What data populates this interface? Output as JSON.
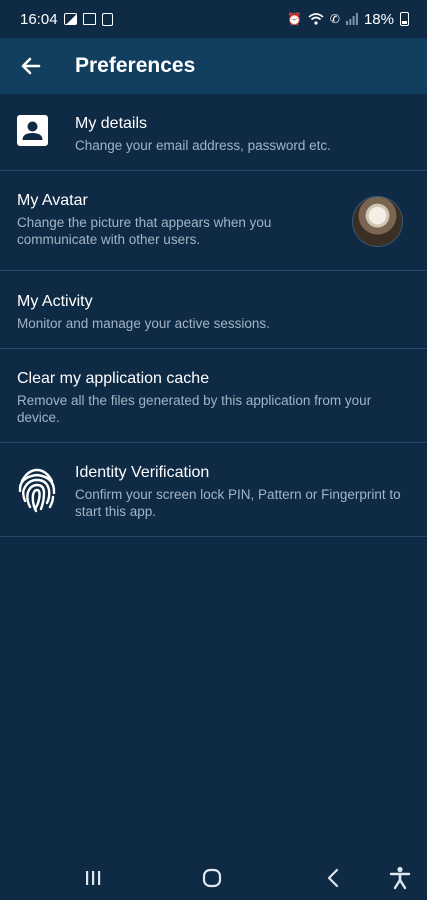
{
  "status_bar": {
    "time": "16:04",
    "battery": "18%"
  },
  "app_bar": {
    "title": "Preferences"
  },
  "items": [
    {
      "title": "My details",
      "subtitle": "Change your email address, password etc."
    },
    {
      "title": "My Avatar",
      "subtitle": "Change the picture that appears when you communicate with other users."
    },
    {
      "title": "My Activity",
      "subtitle": "Monitor and manage your active sessions."
    },
    {
      "title": "Clear my application cache",
      "subtitle": "Remove all the files generated by this application from your device."
    },
    {
      "title": "Identity Verification",
      "subtitle": "Confirm your screen lock PIN, Pattern or Fingerprint to start this app."
    }
  ],
  "icons": {
    "back": "arrow-left-icon",
    "my_details": "contact-card-icon",
    "identity": "fingerprint-icon",
    "avatar": "user-avatar"
  },
  "colors": {
    "background": "#0f2a44",
    "app_bar": "#123e60",
    "subtitle": "#a2b4c6",
    "divider": "#25486a"
  }
}
